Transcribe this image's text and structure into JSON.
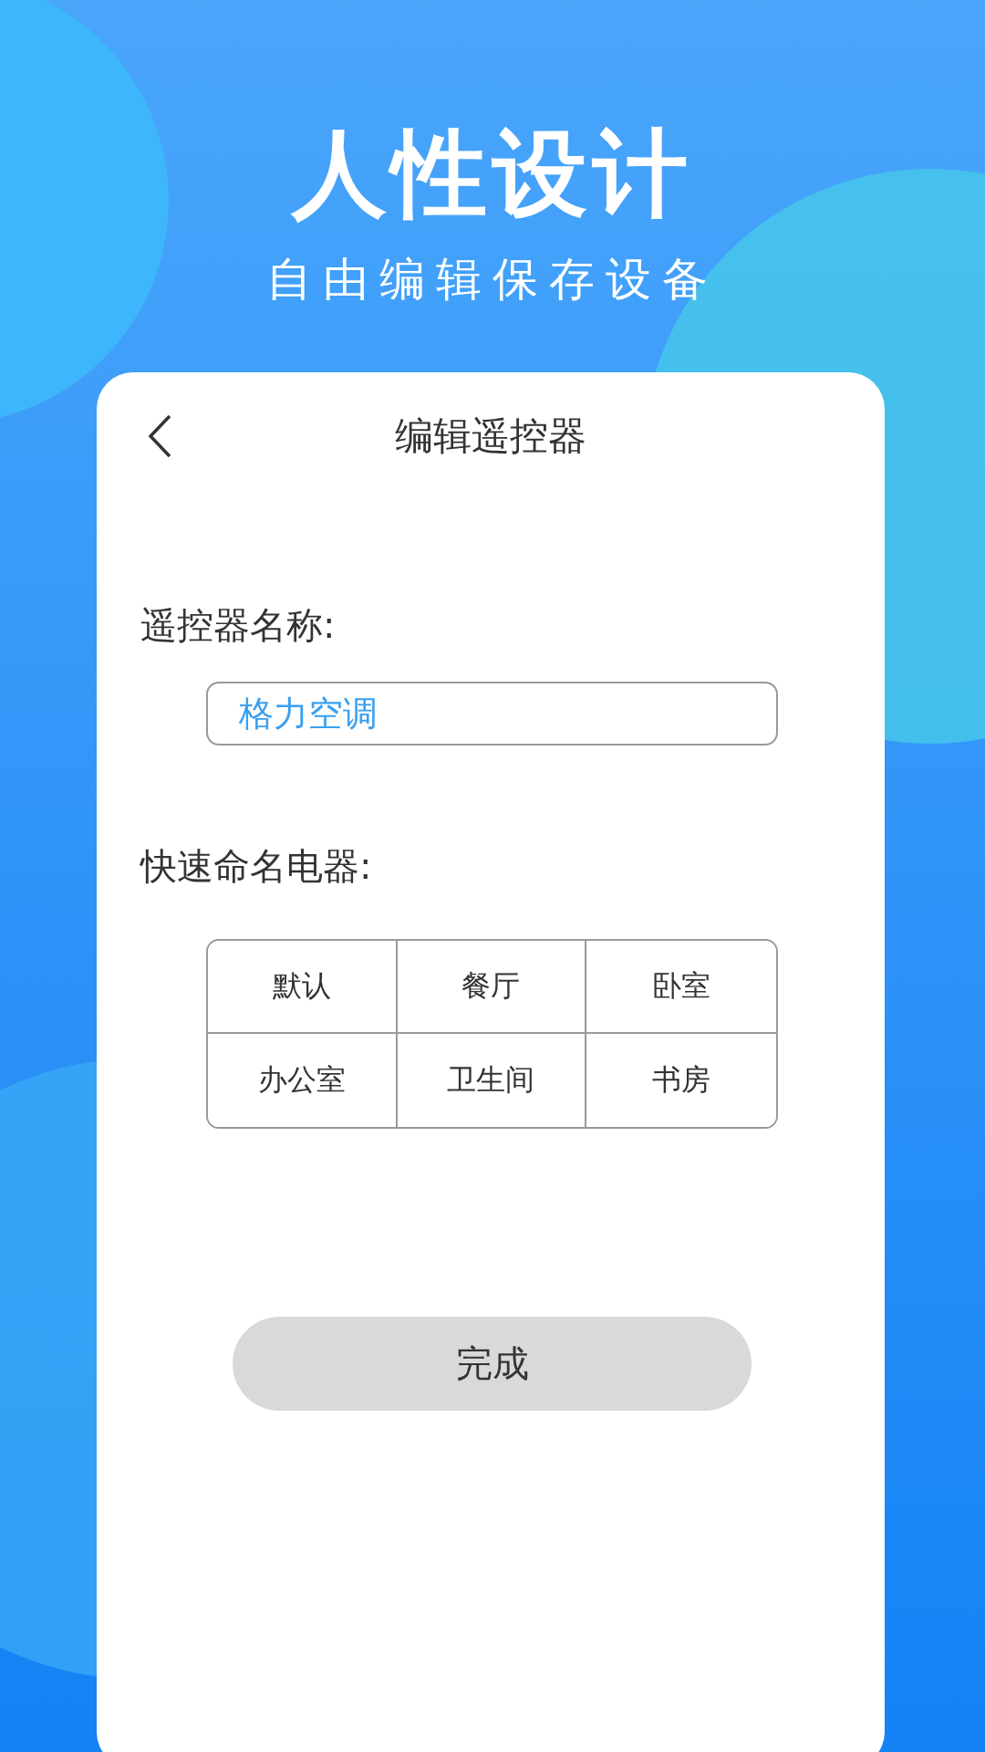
{
  "headline": "人性设计",
  "subheadline": "自由编辑保存设备",
  "screen": {
    "title": "编辑遥控器",
    "name_label": "遥控器名称:",
    "name_field": {
      "value": "格力空调"
    },
    "quick_label": "快速命名电器:",
    "quick_names": [
      "默认",
      "餐厅",
      "卧室",
      "办公室",
      "卫生间",
      "书房"
    ],
    "done_button": "完成"
  }
}
